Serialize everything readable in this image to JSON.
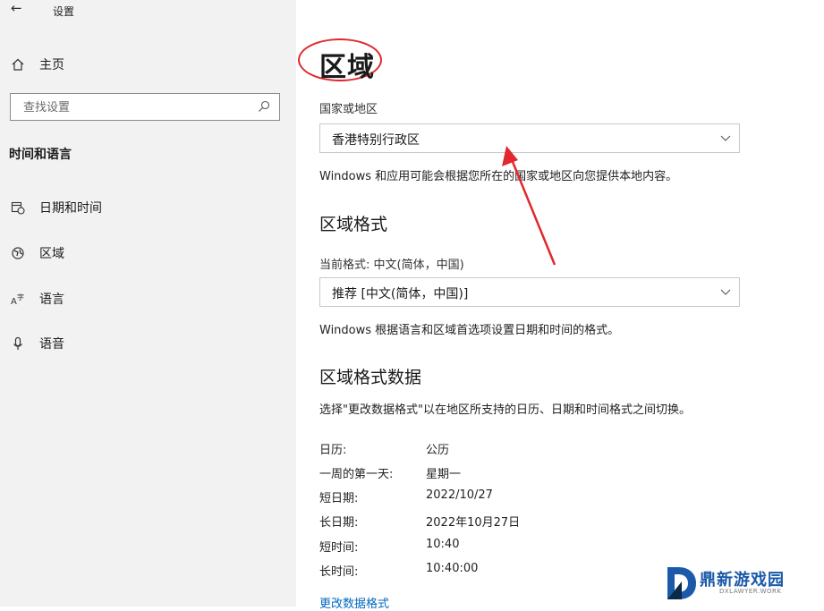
{
  "window": {
    "title": "设置"
  },
  "sidebar": {
    "home_label": "主页",
    "search_placeholder": "查找设置",
    "section_title": "时间和语言",
    "items": [
      {
        "label": "日期和时间",
        "icon": "calendar-clock-icon"
      },
      {
        "label": "区域",
        "icon": "globe-icon"
      },
      {
        "label": "语言",
        "icon": "language-icon"
      },
      {
        "label": "语音",
        "icon": "microphone-icon"
      }
    ]
  },
  "main": {
    "title": "区域",
    "country_label": "国家或地区",
    "country_value": "香港特别行政区",
    "country_desc": "Windows 和应用可能会根据您所在的国家或地区向您提供本地内容。",
    "format_heading": "区域格式",
    "current_format_label": "当前格式: 中文(简体，中国)",
    "format_value": "推荐 [中文(简体，中国)]",
    "format_desc": "Windows 根据语言和区域首选项设置日期和时间的格式。",
    "data_heading": "区域格式数据",
    "data_desc": "选择\"更改数据格式\"以在地区所支持的日历、日期和时间格式之间切换。",
    "rows": [
      {
        "key": "日历:",
        "value": "公历"
      },
      {
        "key": "一周的第一天:",
        "value": "星期一"
      },
      {
        "key": "短日期:",
        "value": "2022/10/27"
      },
      {
        "key": "长日期:",
        "value": "2022年10月27日"
      },
      {
        "key": "短时间:",
        "value": "10:40"
      },
      {
        "key": "长时间:",
        "value": "10:40:00"
      }
    ],
    "change_link": "更改数据格式"
  },
  "watermark": {
    "name": "鼎新游戏园",
    "domain": "DXLAWYER.WORK"
  },
  "colors": {
    "annotation": "#e0282e",
    "link": "#0067c0",
    "sidebar_bg": "#f2f2f2"
  }
}
